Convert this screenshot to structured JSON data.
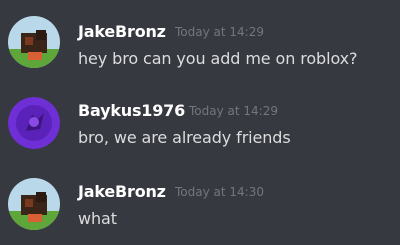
{
  "messages": [
    {
      "username": "JakeBronz",
      "timestamp": "Today at 14:29",
      "text": "hey bro can you add me on roblox?",
      "avatar_icon": "roblox-character-avatar-icon"
    },
    {
      "username": "Baykus1976",
      "timestamp": "Today at 14:29",
      "text": "bro, we are already friends",
      "avatar_icon": "purple-owl-avatar-icon"
    },
    {
      "username": "JakeBronz",
      "timestamp": "Today at 14:30",
      "text": "what",
      "avatar_icon": "roblox-character-avatar-icon"
    }
  ],
  "colors": {
    "background": "#36393f",
    "username": "#ffffff",
    "message_text": "#dcddde",
    "timestamp": "#72767d"
  }
}
